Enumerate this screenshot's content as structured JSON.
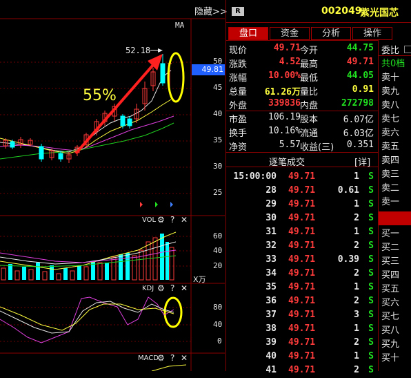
{
  "top": {
    "hide_label": "隐藏>>",
    "badge": "R",
    "code": "002049",
    "name": "紫光国芯"
  },
  "tabs": [
    "盘口",
    "资金",
    "分析",
    "操作"
  ],
  "price_panel": {
    "ma_label": "MA",
    "peak_label": "52.18",
    "current_price_tag": "49.81",
    "annotation": "55%",
    "y_ticks": [
      "50",
      "45",
      "40",
      "35",
      "30",
      "25"
    ]
  },
  "vol_panel": {
    "label": "VOL",
    "y_ticks": [
      "60",
      "40",
      "20"
    ],
    "unit": "X万"
  },
  "kdj_panel": {
    "label": "KDJ",
    "y_ticks": [
      "80",
      "40",
      "0"
    ]
  },
  "macd_panel": {
    "label": "MACD"
  },
  "quote": {
    "rows": [
      {
        "l1": "现价",
        "v1": "49.71",
        "l2": "今开",
        "v2": "44.75"
      },
      {
        "l1": "涨跌",
        "v1": "4.52",
        "l2": "最高",
        "v2": "49.71"
      },
      {
        "l1": "涨幅",
        "v1": "10.00%",
        "l2": "最低",
        "v2": "44.05"
      },
      {
        "l1": "总量",
        "v1": "61.26万",
        "l2": "量比",
        "v2": "0.91"
      },
      {
        "l1": "外盘",
        "v1": "339836",
        "l2": "内盘",
        "v2": "272798"
      }
    ],
    "fund_rows": [
      {
        "l1": "市盈",
        "v1": "106.19",
        "l2": "股本",
        "v2": "6.07亿"
      },
      {
        "l1": "换手",
        "v1": "10.16%",
        "l2": "流通",
        "v2": "6.03亿"
      },
      {
        "l1": "净资",
        "v1": "5.57",
        "l2": "收益(三)",
        "v2": "0.351"
      }
    ]
  },
  "ticks": {
    "title": "逐笔成交",
    "detail": "[详]",
    "rows": [
      {
        "t": "15:00:00",
        "p": "49.71",
        "q": "1",
        "s": "S"
      },
      {
        "t": "28",
        "p": "49.71",
        "q": "0.61",
        "s": "S"
      },
      {
        "t": "29",
        "p": "49.71",
        "q": "1",
        "s": "S"
      },
      {
        "t": "30",
        "p": "49.71",
        "q": "2",
        "s": "S"
      },
      {
        "t": "31",
        "p": "49.71",
        "q": "1",
        "s": "S"
      },
      {
        "t": "32",
        "p": "49.71",
        "q": "2",
        "s": "S"
      },
      {
        "t": "33",
        "p": "49.71",
        "q": "0.39",
        "s": "S"
      },
      {
        "t": "34",
        "p": "49.71",
        "q": "2",
        "s": "S"
      },
      {
        "t": "35",
        "p": "49.71",
        "q": "1",
        "s": "S"
      },
      {
        "t": "36",
        "p": "49.71",
        "q": "2",
        "s": "S"
      },
      {
        "t": "37",
        "p": "49.71",
        "q": "3",
        "s": "S"
      },
      {
        "t": "38",
        "p": "49.71",
        "q": "1",
        "s": "S"
      },
      {
        "t": "39",
        "p": "49.71",
        "q": "2",
        "s": "S"
      },
      {
        "t": "40",
        "p": "49.71",
        "q": "1",
        "s": "S"
      },
      {
        "t": "41",
        "p": "49.71",
        "q": "2",
        "s": "S"
      }
    ]
  },
  "order_book": {
    "header": "委比",
    "levels": [
      "共0档",
      "卖十",
      "卖九",
      "卖八",
      "卖七",
      "卖六",
      "卖五",
      "卖四",
      "卖三",
      "卖二",
      "卖一",
      "",
      "买一",
      "买二",
      "买三",
      "买四",
      "买五",
      "买六",
      "买七",
      "买八",
      "买九",
      "买十"
    ]
  },
  "colors": {
    "up": "#ff3b3b",
    "down": "#00ffff",
    "accent": "#ffff00",
    "grid": "#8b0000"
  }
}
